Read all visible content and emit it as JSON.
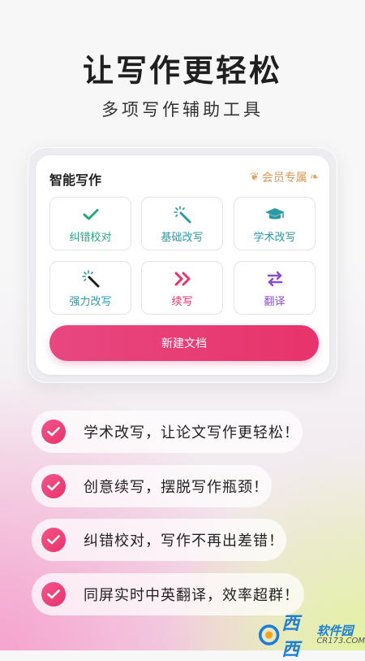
{
  "header": {
    "title": "让写作更轻松",
    "subtitle": "多项写作辅助工具"
  },
  "card": {
    "title": "智能写作",
    "vip_badge": "会员专属",
    "tools": [
      {
        "label": "纠错校对",
        "icon": "checkmark-icon",
        "color": "#2aa57a"
      },
      {
        "label": "基础改写",
        "icon": "magic-wand-icon",
        "color": "#2a9aa5"
      },
      {
        "label": "学术改写",
        "icon": "graduation-cap-icon",
        "color": "#2a9aa5"
      },
      {
        "label": "强力改写",
        "icon": "magic-wand-icon",
        "color": "#2a9aa5"
      },
      {
        "label": "续写",
        "icon": "double-chevron-right-icon",
        "color": "#e8336b"
      },
      {
        "label": "翻译",
        "icon": "swap-arrows-icon",
        "color": "#8b4ccf"
      }
    ],
    "new_doc_button": "新建文档"
  },
  "features": [
    "学术改写，让论文写作更轻松！",
    "创意续写，摆脱写作瓶颈！",
    "纠错校对，写作不再出差错！",
    "同屏实时中英翻译，效率超群！"
  ],
  "watermark": {
    "cn": "西西",
    "cn2": "软件园",
    "en": "CR173.COM"
  },
  "colors": {
    "accent": "#e8336b",
    "teal": "#2a9aa5",
    "green": "#2aa57a",
    "purple": "#8b4ccf",
    "gold": "#d59a55"
  }
}
